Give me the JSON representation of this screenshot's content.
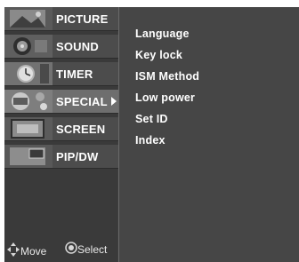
{
  "menu": {
    "items": [
      {
        "label": "PICTURE",
        "icon": "picture-icon"
      },
      {
        "label": "SOUND",
        "icon": "sound-icon"
      },
      {
        "label": "TIMER",
        "icon": "timer-icon"
      },
      {
        "label": "SPECIAL",
        "icon": "special-icon",
        "active": true
      },
      {
        "label": "SCREEN",
        "icon": "screen-icon"
      },
      {
        "label": "PIP/DW",
        "icon": "pip-icon"
      }
    ]
  },
  "submenu": {
    "items": [
      "Language",
      "Key lock",
      "ISM Method",
      "Low power",
      "Set ID",
      "Index"
    ]
  },
  "footer": {
    "move_label": "Move",
    "select_label": "Select"
  },
  "colors": {
    "panel_bg": "#3d3d3d",
    "item_bg": "#4c4c4c",
    "active_bg": "#6e6e6e",
    "text": "#ffffff"
  }
}
